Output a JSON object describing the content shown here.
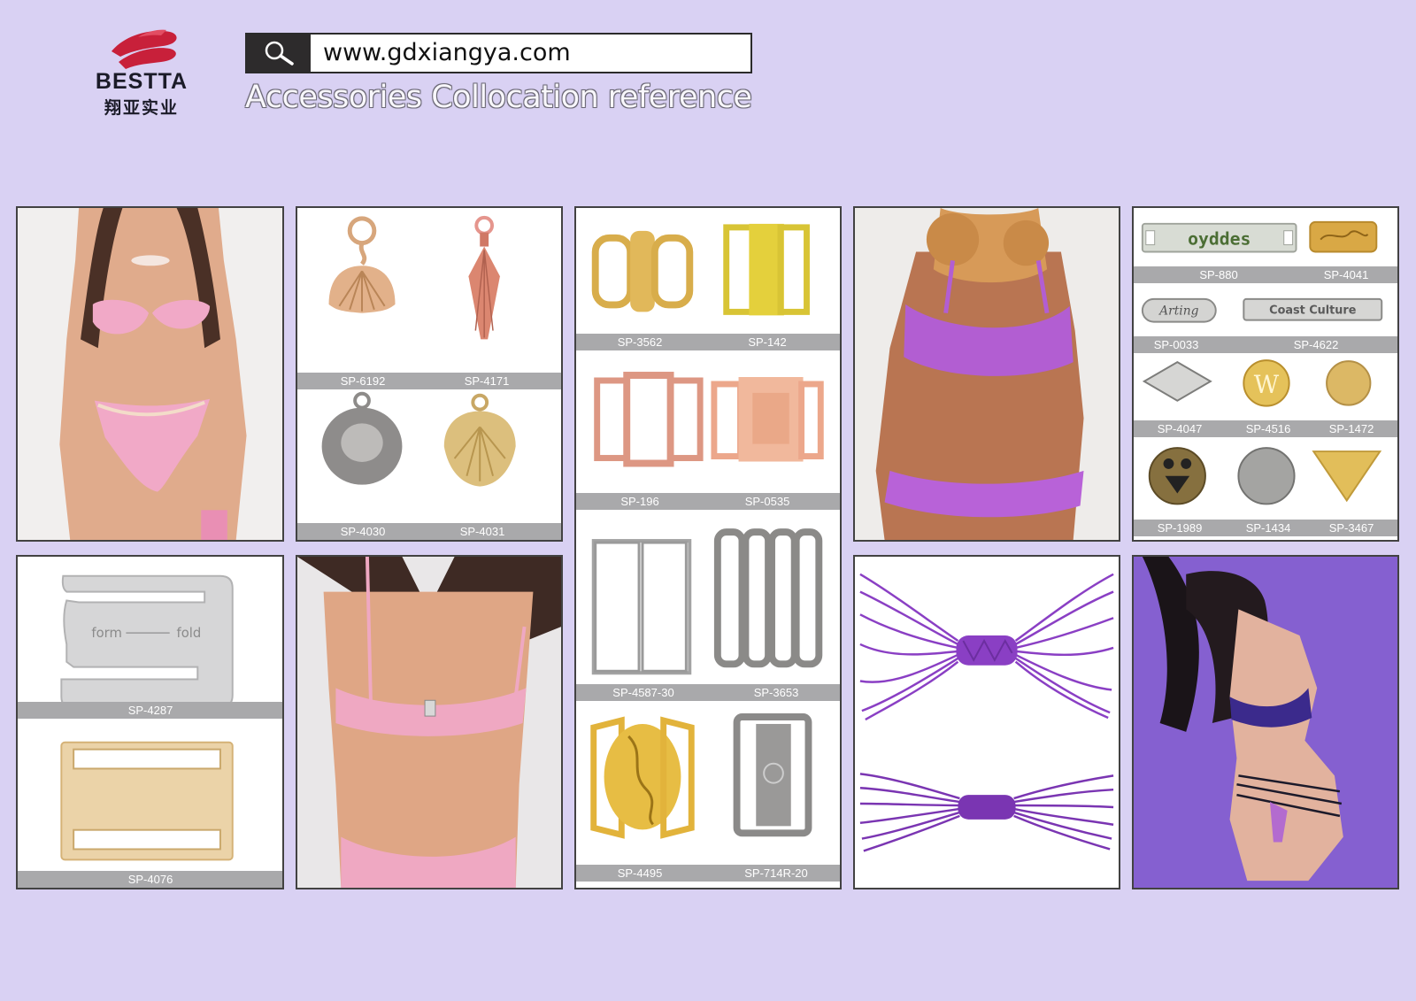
{
  "header": {
    "brand_name": "BESTTA",
    "brand_cn": "翔亚实业",
    "url": "www.gdxiangya.com",
    "subtitle": "Accessories Collocation reference"
  },
  "icons": {
    "logo": "bestta-logo-icon",
    "search": "search-icon"
  },
  "colors": {
    "background": "#d9d1f3",
    "label_bar": "#a9a9ab",
    "brand_red": "#c8203a"
  },
  "panels": {
    "pendants": [
      "SP-6192",
      "SP-4171",
      "SP-4030",
      "SP-4031"
    ],
    "buckles_row1": [
      "SP-3562",
      "SP-142"
    ],
    "buckles_row2": [
      "SP-196",
      "SP-0535"
    ],
    "buckles_row3": [
      "SP-4587-30",
      "SP-3653"
    ],
    "buckles_row4": [
      "SP-4495",
      "SP-714R-20"
    ],
    "tags_row1": [
      "SP-880",
      "SP-4041"
    ],
    "tags_row2": [
      "SP-0033",
      "SP-4622"
    ],
    "tags_row3": [
      "SP-4047",
      "SP-4516",
      "SP-1472"
    ],
    "tags_row4": [
      "SP-1989",
      "SP-1434",
      "SP-3467"
    ],
    "hooks": [
      "SP-4287",
      "SP-4076"
    ],
    "hook_engraving": [
      "form",
      "fold"
    ],
    "tag_engravings": [
      "oyddes",
      "Arting",
      "Coast Culture",
      "W"
    ]
  }
}
